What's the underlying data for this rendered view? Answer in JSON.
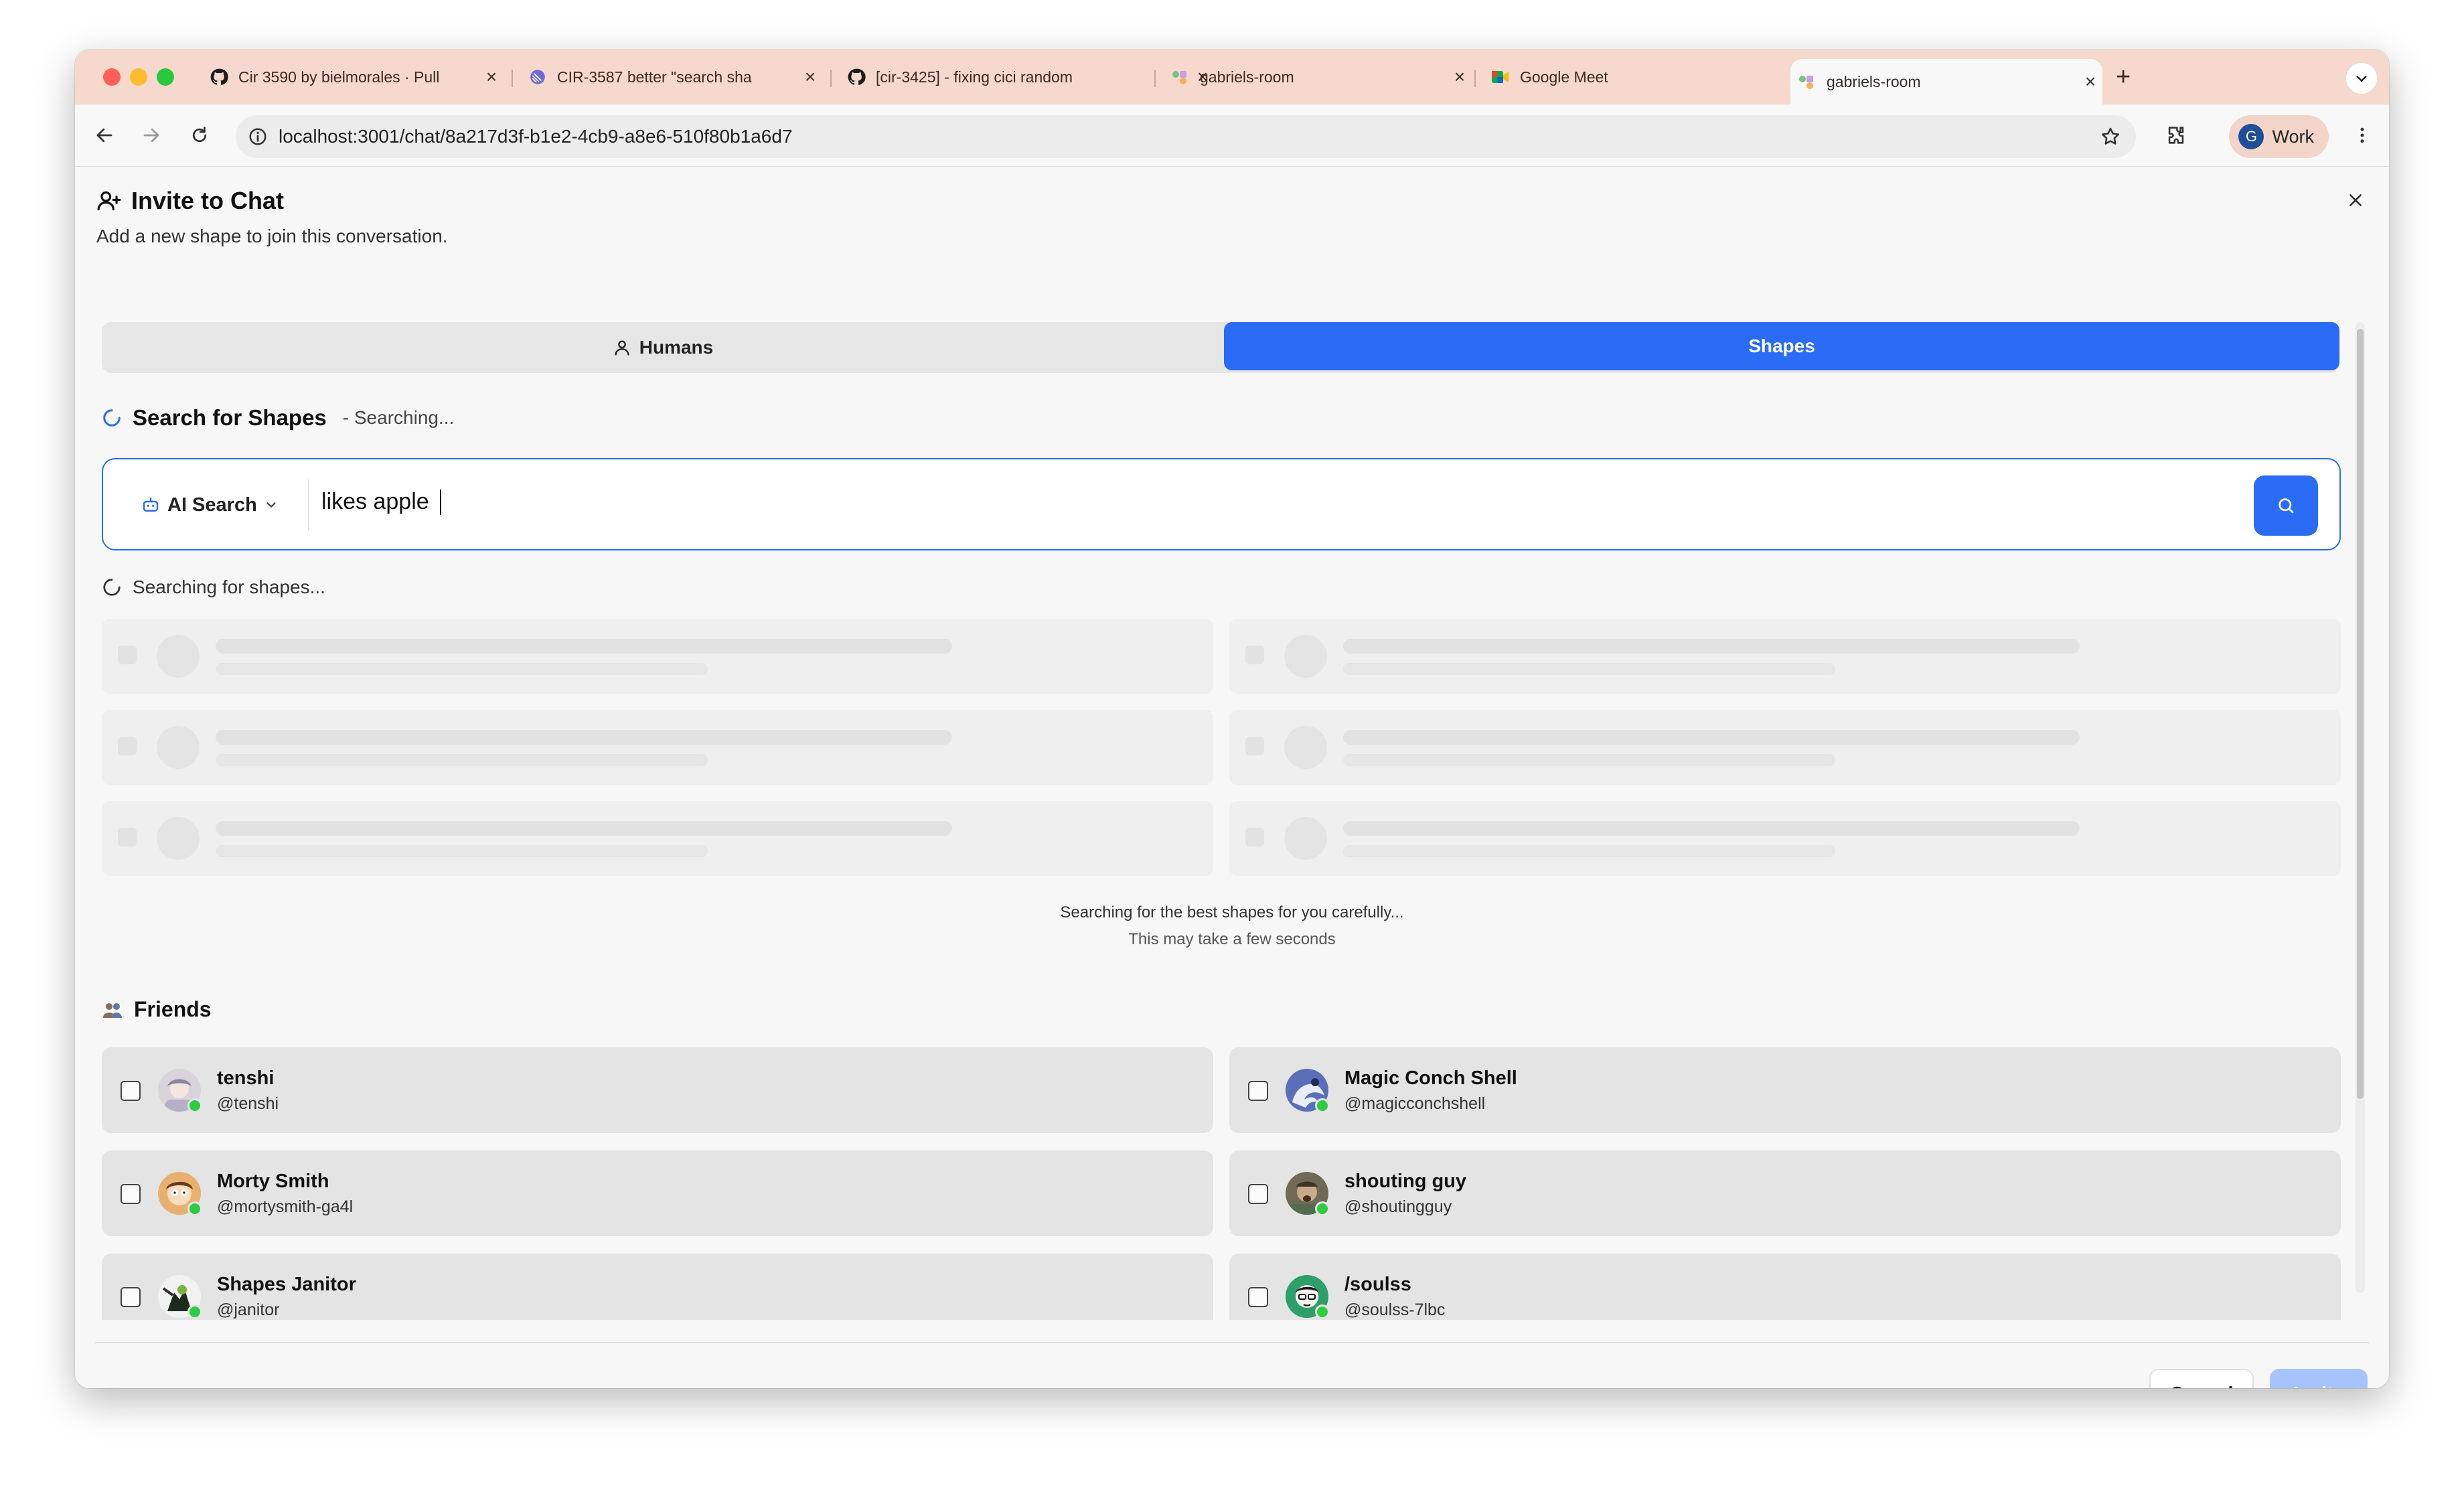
{
  "browser": {
    "tabs": [
      {
        "title": "Cir 3590 by bielmorales · Pull",
        "icon": "github-icon"
      },
      {
        "title": "CIR-3587 better \"search sha",
        "icon": "linear-icon"
      },
      {
        "title": "[cir-3425] - fixing cici random",
        "icon": "github-icon"
      },
      {
        "title": "gabriels-room",
        "icon": "shapes-icon"
      },
      {
        "title": "Google Meet",
        "icon": "google-meet-icon"
      },
      {
        "title": "gabriels-room",
        "icon": "shapes-icon",
        "active": true
      }
    ],
    "url": "localhost:3001/chat/8a217d3f-b1e2-4cb9-a8e6-510f80b1a6d7",
    "profile": {
      "initial": "G",
      "label": "Work"
    }
  },
  "dialog": {
    "title": "Invite to Chat",
    "subtitle": "Add a new shape to join this conversation.",
    "tabs": {
      "humans": "Humans",
      "shapes": "Shapes",
      "selected": "Shapes"
    },
    "search": {
      "heading": "Search for Shapes",
      "status": "- Searching...",
      "mode": "AI Search",
      "query": "likes apple",
      "searching_label": "Searching for shapes...",
      "loading_line1": "Searching for the best shapes for you carefully...",
      "loading_line2": "This may take a few seconds"
    },
    "friends": {
      "heading": "Friends",
      "items": [
        {
          "name": "tenshi",
          "handle": "@tenshi",
          "online": true
        },
        {
          "name": "Magic Conch Shell",
          "handle": "@magicconchshell",
          "online": true
        },
        {
          "name": "Morty Smith",
          "handle": "@mortysmith-ga4l",
          "online": true
        },
        {
          "name": "shouting guy",
          "handle": "@shoutingguy",
          "online": true
        },
        {
          "name": "Shapes Janitor",
          "handle": "@janitor",
          "online": true
        },
        {
          "name": "/soulss",
          "handle": "@soulss-7lbc",
          "online": true
        }
      ]
    },
    "buttons": {
      "cancel": "Cancel",
      "invite": "Invite"
    }
  },
  "colors": {
    "accent": "#2b6cf6",
    "tab_strip": "#f6d8cd",
    "online": "#2ecc40",
    "invite_disabled": "#a6c4fb"
  }
}
